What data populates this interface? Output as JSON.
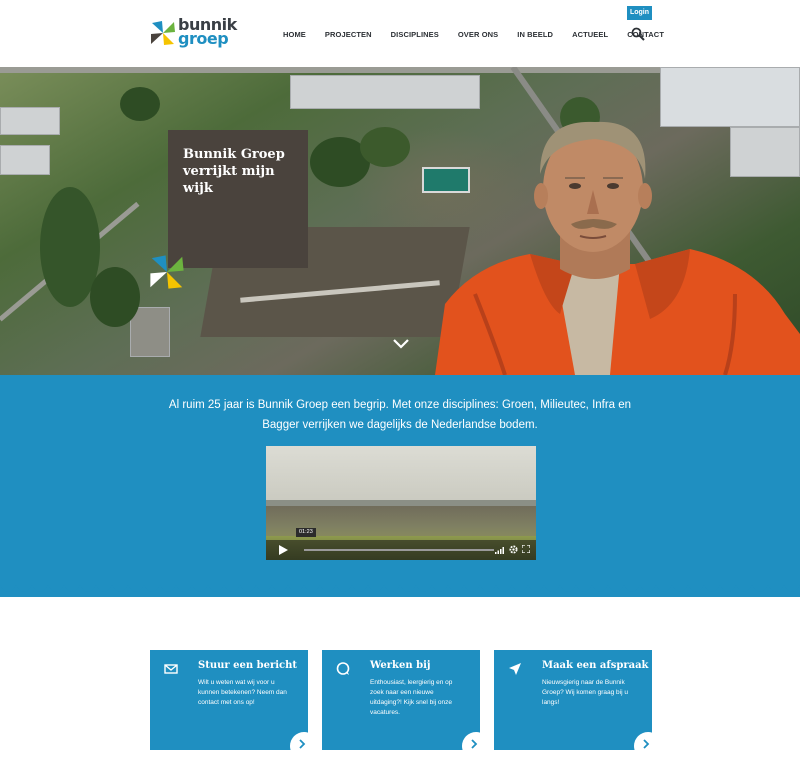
{
  "header": {
    "logo": {
      "line1": "bunnik",
      "line2": "groep"
    },
    "login_label": "Login",
    "nav": [
      {
        "label": "HOME"
      },
      {
        "label": "PROJECTEN"
      },
      {
        "label": "DISCIPLINES"
      },
      {
        "label": "OVER ONS"
      },
      {
        "label": "IN BEELD"
      },
      {
        "label": "ACTUEEL"
      },
      {
        "label": "CONTACT"
      }
    ],
    "search_icon": "search-icon"
  },
  "hero": {
    "headline": "Bunnik Groep verrijkt mijn wijk",
    "scroll_icon": "chevron-down-icon"
  },
  "intro": {
    "text": "Al ruim 25 jaar is Bunnik Groep een begrip. Met onze disciplines: Groen, Milieutec, Infra en Bagger verrijken we dagelijks de Nederlandse bodem.",
    "video": {
      "time": "01:23",
      "progress": 0
    }
  },
  "cards": [
    {
      "icon": "mail-icon",
      "title": "Stuur een bericht",
      "text": "Wilt u weten wat wij voor u kunnen betekenen? Neem dan contact met ons op!"
    },
    {
      "icon": "chat-icon",
      "title": "Werken bij",
      "text": "Enthousiast, leergierig en op zoek naar een nieuwe uitdaging?! Kijk snel bij onze vacatures."
    },
    {
      "icon": "location-arrow-icon",
      "title": "Maak een afspraak",
      "text": "Nieuwsgierig naar de Bunnik Groep? Wij komen graag bij u langs!"
    }
  ],
  "colors": {
    "brand_blue": "#1f8fc1",
    "dark": "#4a433d"
  }
}
